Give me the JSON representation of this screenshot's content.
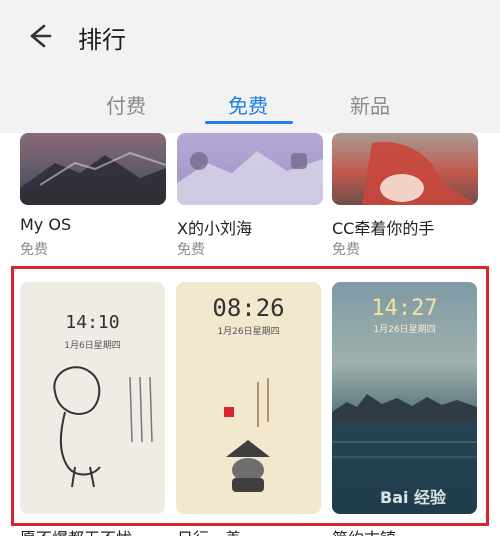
{
  "header": {
    "title": "排行"
  },
  "tabs": [
    {
      "label": "付费"
    },
    {
      "label": "免费"
    },
    {
      "label": "新品"
    }
  ],
  "themes_top": [
    {
      "name": "My OS",
      "price": "免费"
    },
    {
      "name": "X的小刘海",
      "price": "免费"
    },
    {
      "name": "CC牵着你的手",
      "price": "免费"
    }
  ],
  "previews": [
    {
      "time": "14:10",
      "date": "1月6日星期四"
    },
    {
      "time": "08:26",
      "date": "1月26日星期四"
    },
    {
      "time": "14:27",
      "date": "1月26日星期四"
    }
  ],
  "themes_bottom": [
    {
      "name": "愿不爆都无不忧"
    },
    {
      "name": "日行一善"
    },
    {
      "name": "简约古镇"
    }
  ],
  "watermark": "Bai 经验",
  "accent_color": "#1f7fe6",
  "highlight_color": "#d8262c"
}
